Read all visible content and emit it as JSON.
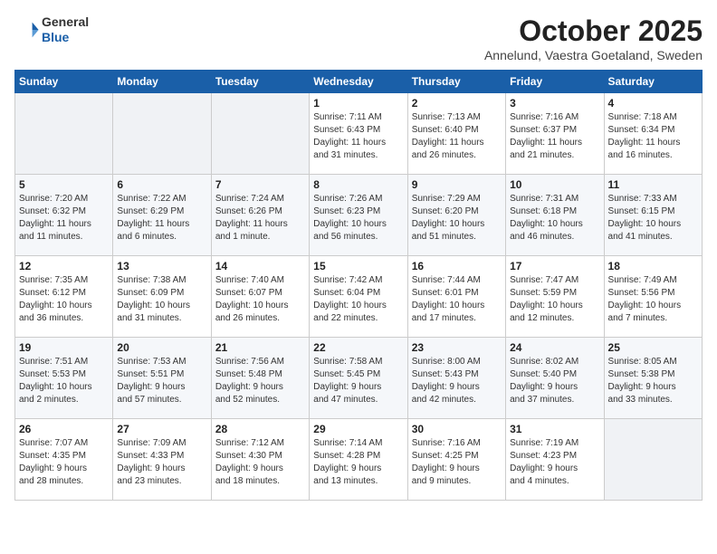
{
  "header": {
    "logo_general": "General",
    "logo_blue": "Blue",
    "month_title": "October 2025",
    "location": "Annelund, Vaestra Goetaland, Sweden"
  },
  "days_of_week": [
    "Sunday",
    "Monday",
    "Tuesday",
    "Wednesday",
    "Thursday",
    "Friday",
    "Saturday"
  ],
  "weeks": [
    [
      {
        "day": "",
        "info": ""
      },
      {
        "day": "",
        "info": ""
      },
      {
        "day": "",
        "info": ""
      },
      {
        "day": "1",
        "info": "Sunrise: 7:11 AM\nSunset: 6:43 PM\nDaylight: 11 hours\nand 31 minutes."
      },
      {
        "day": "2",
        "info": "Sunrise: 7:13 AM\nSunset: 6:40 PM\nDaylight: 11 hours\nand 26 minutes."
      },
      {
        "day": "3",
        "info": "Sunrise: 7:16 AM\nSunset: 6:37 PM\nDaylight: 11 hours\nand 21 minutes."
      },
      {
        "day": "4",
        "info": "Sunrise: 7:18 AM\nSunset: 6:34 PM\nDaylight: 11 hours\nand 16 minutes."
      }
    ],
    [
      {
        "day": "5",
        "info": "Sunrise: 7:20 AM\nSunset: 6:32 PM\nDaylight: 11 hours\nand 11 minutes."
      },
      {
        "day": "6",
        "info": "Sunrise: 7:22 AM\nSunset: 6:29 PM\nDaylight: 11 hours\nand 6 minutes."
      },
      {
        "day": "7",
        "info": "Sunrise: 7:24 AM\nSunset: 6:26 PM\nDaylight: 11 hours\nand 1 minute."
      },
      {
        "day": "8",
        "info": "Sunrise: 7:26 AM\nSunset: 6:23 PM\nDaylight: 10 hours\nand 56 minutes."
      },
      {
        "day": "9",
        "info": "Sunrise: 7:29 AM\nSunset: 6:20 PM\nDaylight: 10 hours\nand 51 minutes."
      },
      {
        "day": "10",
        "info": "Sunrise: 7:31 AM\nSunset: 6:18 PM\nDaylight: 10 hours\nand 46 minutes."
      },
      {
        "day": "11",
        "info": "Sunrise: 7:33 AM\nSunset: 6:15 PM\nDaylight: 10 hours\nand 41 minutes."
      }
    ],
    [
      {
        "day": "12",
        "info": "Sunrise: 7:35 AM\nSunset: 6:12 PM\nDaylight: 10 hours\nand 36 minutes."
      },
      {
        "day": "13",
        "info": "Sunrise: 7:38 AM\nSunset: 6:09 PM\nDaylight: 10 hours\nand 31 minutes."
      },
      {
        "day": "14",
        "info": "Sunrise: 7:40 AM\nSunset: 6:07 PM\nDaylight: 10 hours\nand 26 minutes."
      },
      {
        "day": "15",
        "info": "Sunrise: 7:42 AM\nSunset: 6:04 PM\nDaylight: 10 hours\nand 22 minutes."
      },
      {
        "day": "16",
        "info": "Sunrise: 7:44 AM\nSunset: 6:01 PM\nDaylight: 10 hours\nand 17 minutes."
      },
      {
        "day": "17",
        "info": "Sunrise: 7:47 AM\nSunset: 5:59 PM\nDaylight: 10 hours\nand 12 minutes."
      },
      {
        "day": "18",
        "info": "Sunrise: 7:49 AM\nSunset: 5:56 PM\nDaylight: 10 hours\nand 7 minutes."
      }
    ],
    [
      {
        "day": "19",
        "info": "Sunrise: 7:51 AM\nSunset: 5:53 PM\nDaylight: 10 hours\nand 2 minutes."
      },
      {
        "day": "20",
        "info": "Sunrise: 7:53 AM\nSunset: 5:51 PM\nDaylight: 9 hours\nand 57 minutes."
      },
      {
        "day": "21",
        "info": "Sunrise: 7:56 AM\nSunset: 5:48 PM\nDaylight: 9 hours\nand 52 minutes."
      },
      {
        "day": "22",
        "info": "Sunrise: 7:58 AM\nSunset: 5:45 PM\nDaylight: 9 hours\nand 47 minutes."
      },
      {
        "day": "23",
        "info": "Sunrise: 8:00 AM\nSunset: 5:43 PM\nDaylight: 9 hours\nand 42 minutes."
      },
      {
        "day": "24",
        "info": "Sunrise: 8:02 AM\nSunset: 5:40 PM\nDaylight: 9 hours\nand 37 minutes."
      },
      {
        "day": "25",
        "info": "Sunrise: 8:05 AM\nSunset: 5:38 PM\nDaylight: 9 hours\nand 33 minutes."
      }
    ],
    [
      {
        "day": "26",
        "info": "Sunrise: 7:07 AM\nSunset: 4:35 PM\nDaylight: 9 hours\nand 28 minutes."
      },
      {
        "day": "27",
        "info": "Sunrise: 7:09 AM\nSunset: 4:33 PM\nDaylight: 9 hours\nand 23 minutes."
      },
      {
        "day": "28",
        "info": "Sunrise: 7:12 AM\nSunset: 4:30 PM\nDaylight: 9 hours\nand 18 minutes."
      },
      {
        "day": "29",
        "info": "Sunrise: 7:14 AM\nSunset: 4:28 PM\nDaylight: 9 hours\nand 13 minutes."
      },
      {
        "day": "30",
        "info": "Sunrise: 7:16 AM\nSunset: 4:25 PM\nDaylight: 9 hours\nand 9 minutes."
      },
      {
        "day": "31",
        "info": "Sunrise: 7:19 AM\nSunset: 4:23 PM\nDaylight: 9 hours\nand 4 minutes."
      },
      {
        "day": "",
        "info": ""
      }
    ]
  ]
}
